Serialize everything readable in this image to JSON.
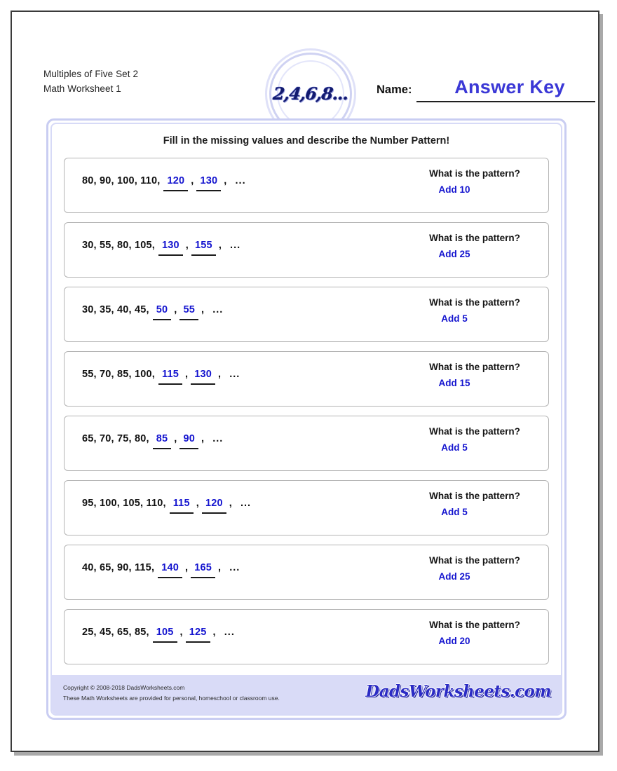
{
  "worksheet": {
    "title_line_1": "Multiples of Five Set 2",
    "title_line_2": "Math Worksheet 1",
    "logo_text": "2,4,6,8...",
    "name_label": "Name:",
    "name_value": "Answer Key",
    "instructions": "Fill in the missing values and describe the Number Pattern!",
    "accent_blue": "#1414cf",
    "answer_key_blue": "#3b38d6",
    "panel_border": "#c9cdf2",
    "footer_band": "#d9dbf7"
  },
  "problems": [
    {
      "given": "80,  90,  100,  110,",
      "blank_1": "120",
      "blank_2": "130",
      "comma_1": ",",
      "comma_2": ",",
      "ellipsis": "...",
      "pattern_question": "What is the pattern?",
      "pattern_answer": "Add 10"
    },
    {
      "given": "30,  55,  80,  105,",
      "blank_1": "130",
      "blank_2": "155",
      "comma_1": ",",
      "comma_2": ",",
      "ellipsis": "...",
      "pattern_question": "What is the pattern?",
      "pattern_answer": "Add 25"
    },
    {
      "given": "30,  35,  40,  45,",
      "blank_1": "50",
      "blank_2": "55",
      "comma_1": ",",
      "comma_2": ",",
      "ellipsis": "...",
      "pattern_question": "What is the pattern?",
      "pattern_answer": "Add 5"
    },
    {
      "given": "55,  70,  85,  100,",
      "blank_1": "115",
      "blank_2": "130",
      "comma_1": ",",
      "comma_2": ",",
      "ellipsis": "...",
      "pattern_question": "What is the pattern?",
      "pattern_answer": "Add 15"
    },
    {
      "given": "65,  70,  75,  80,",
      "blank_1": "85",
      "blank_2": "90",
      "comma_1": ",",
      "comma_2": ",",
      "ellipsis": "...",
      "pattern_question": "What is the pattern?",
      "pattern_answer": "Add 5"
    },
    {
      "given": "95,  100,  105,  110,",
      "blank_1": "115",
      "blank_2": "120",
      "comma_1": ",",
      "comma_2": ",",
      "ellipsis": "...",
      "pattern_question": "What is the pattern?",
      "pattern_answer": "Add 5"
    },
    {
      "given": "40,  65,  90,  115,",
      "blank_1": "140",
      "blank_2": "165",
      "comma_1": ",",
      "comma_2": ",",
      "ellipsis": "...",
      "pattern_question": "What is the pattern?",
      "pattern_answer": "Add 25"
    },
    {
      "given": "25,  45,  65,  85,",
      "blank_1": "105",
      "blank_2": "125",
      "comma_1": ",",
      "comma_2": ",",
      "ellipsis": "...",
      "pattern_question": "What is the pattern?",
      "pattern_answer": "Add 20"
    }
  ],
  "footer": {
    "copyright": "Copyright © 2008-2018 DadsWorksheets.com",
    "usage": "These Math Worksheets are provided for personal, homeschool or classroom use.",
    "brand": "DadsWorksheets.com"
  }
}
